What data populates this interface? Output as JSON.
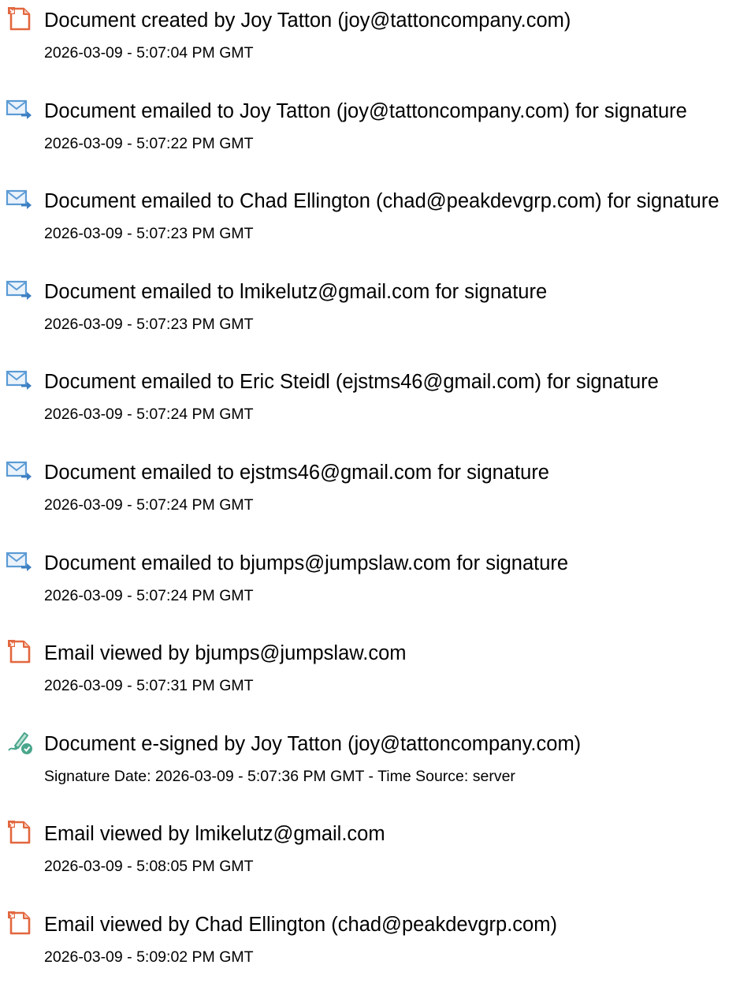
{
  "entries": [
    {
      "icon": "document-icon",
      "title": "Document created by Joy Tatton (joy@tattoncompany.com)",
      "detail": "2026-03-09 - 5:07:04 PM GMT"
    },
    {
      "icon": "email-sent-icon",
      "title": "Document emailed to Joy Tatton (joy@tattoncompany.com) for signature",
      "detail": "2026-03-09 - 5:07:22 PM GMT"
    },
    {
      "icon": "email-sent-icon",
      "title": "Document emailed to Chad Ellington (chad@peakdevgrp.com) for signature",
      "detail": "2026-03-09 - 5:07:23 PM GMT"
    },
    {
      "icon": "email-sent-icon",
      "title": "Document emailed to lmikelutz@gmail.com for signature",
      "detail": "2026-03-09 - 5:07:23 PM GMT"
    },
    {
      "icon": "email-sent-icon",
      "title": "Document emailed to Eric Steidl (ejstms46@gmail.com) for signature",
      "detail": "2026-03-09 - 5:07:24 PM GMT"
    },
    {
      "icon": "email-sent-icon",
      "title": "Document emailed to ejstms46@gmail.com for signature",
      "detail": "2026-03-09 - 5:07:24 PM GMT"
    },
    {
      "icon": "email-sent-icon",
      "title": "Document emailed to bjumps@jumpslaw.com for signature",
      "detail": "2026-03-09 - 5:07:24 PM GMT"
    },
    {
      "icon": "document-icon",
      "title": "Email viewed by bjumps@jumpslaw.com",
      "detail": "2026-03-09 - 5:07:31 PM GMT"
    },
    {
      "icon": "esign-icon",
      "title": "Document e-signed by Joy Tatton (joy@tattoncompany.com)",
      "detail": "Signature Date: 2026-03-09 - 5:07:36 PM GMT - Time Source: server"
    },
    {
      "icon": "document-icon",
      "title": "Email viewed by lmikelutz@gmail.com",
      "detail": "2026-03-09 - 5:08:05 PM GMT"
    },
    {
      "icon": "document-icon",
      "title": "Email viewed by Chad Ellington (chad@peakdevgrp.com)",
      "detail": "2026-03-09 - 5:09:02 PM GMT"
    }
  ],
  "colors": {
    "document_icon": "#e2673f",
    "email_icon": "#5b9bd5",
    "esign_icon": "#4aa68c",
    "text": "#000000"
  }
}
